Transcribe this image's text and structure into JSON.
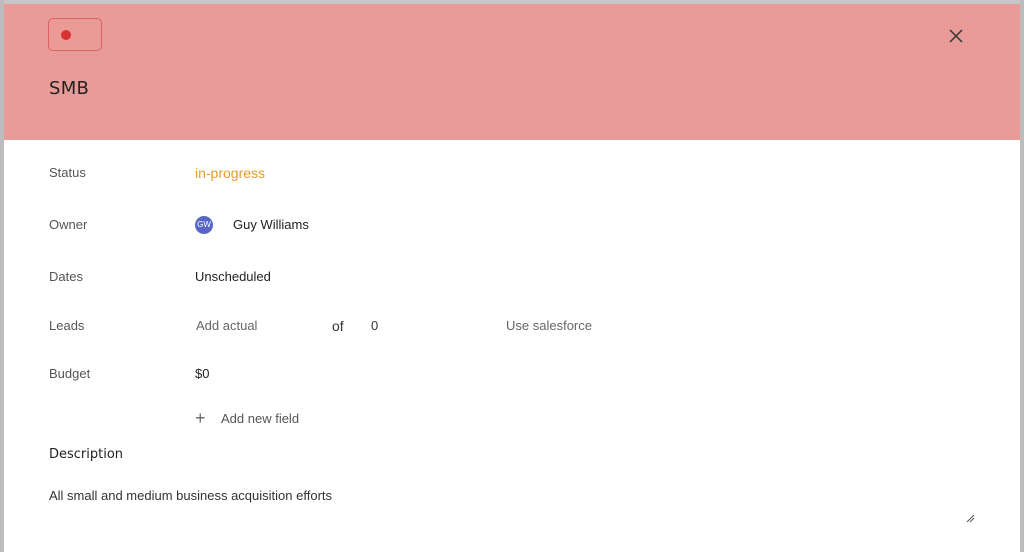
{
  "header": {
    "title": "SMB",
    "color_chip": {
      "dot_color": "#d93232"
    },
    "close_icon": "close-icon"
  },
  "fields": {
    "status": {
      "label": "Status",
      "value": "in-progress",
      "color": "#e89a2c"
    },
    "owner": {
      "label": "Owner",
      "avatar_initials": "GW",
      "name": "Guy Williams"
    },
    "dates": {
      "label": "Dates",
      "value": "Unscheduled"
    },
    "leads": {
      "label": "Leads",
      "actual_placeholder": "Add actual",
      "of_text": "of",
      "target": "0",
      "salesforce_link": "Use salesforce"
    },
    "budget": {
      "label": "Budget",
      "value": "$0"
    }
  },
  "add_field": {
    "label": "Add new field",
    "icon": "plus-icon"
  },
  "description": {
    "heading": "Description",
    "text": "All small and medium business acquisition efforts"
  }
}
